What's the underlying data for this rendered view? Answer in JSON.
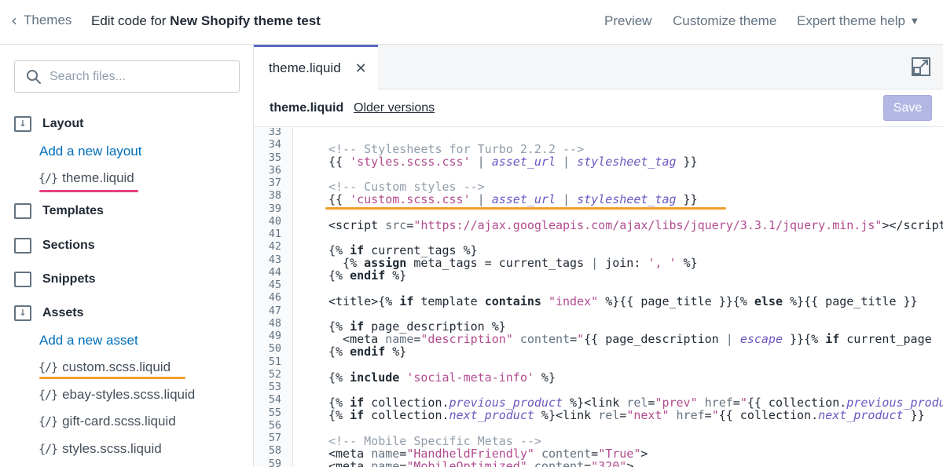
{
  "header": {
    "back_label": "Themes",
    "title_prefix": "Edit code for ",
    "title_theme": "New Shopify theme test",
    "nav": {
      "preview": "Preview",
      "customize": "Customize theme",
      "help": "Expert theme help"
    }
  },
  "sidebar": {
    "search_placeholder": "Search files...",
    "folders": {
      "layout": "Layout",
      "templates": "Templates",
      "sections": "Sections",
      "snippets": "Snippets",
      "assets": "Assets"
    },
    "add_layout": "Add a new layout",
    "add_asset": "Add a new asset",
    "file_icon_text": "{/}",
    "layout_files": [
      "theme.liquid"
    ],
    "asset_files": [
      "custom.scss.liquid",
      "ebay-styles.scss.liquid",
      "gift-card.scss.liquid",
      "styles.scss.liquid"
    ]
  },
  "editor": {
    "tab_label": "theme.liquid",
    "file_name": "theme.liquid",
    "older_versions": "Older versions",
    "save_label": "Save",
    "line_numbers": [
      "33",
      "34",
      "35",
      "36",
      "37",
      "38",
      "39",
      "40",
      "41",
      "42",
      "43",
      "44",
      "45",
      "46",
      "47",
      "48",
      "49",
      "50",
      "51",
      "52",
      "53",
      "54",
      "55",
      "56",
      "57",
      "58",
      "59"
    ],
    "code": {
      "l34": "<!-- Stylesheets for Turbo 2.2.2 -->",
      "l37": "<!-- Custom styles -->",
      "l57": "<!-- Mobile Specific Metas -->"
    }
  },
  "colors": {
    "accent": "#5c6ac4",
    "link": "#006fbb",
    "highlight_pink": "#e8407f",
    "highlight_orange": "#f29d2e"
  }
}
